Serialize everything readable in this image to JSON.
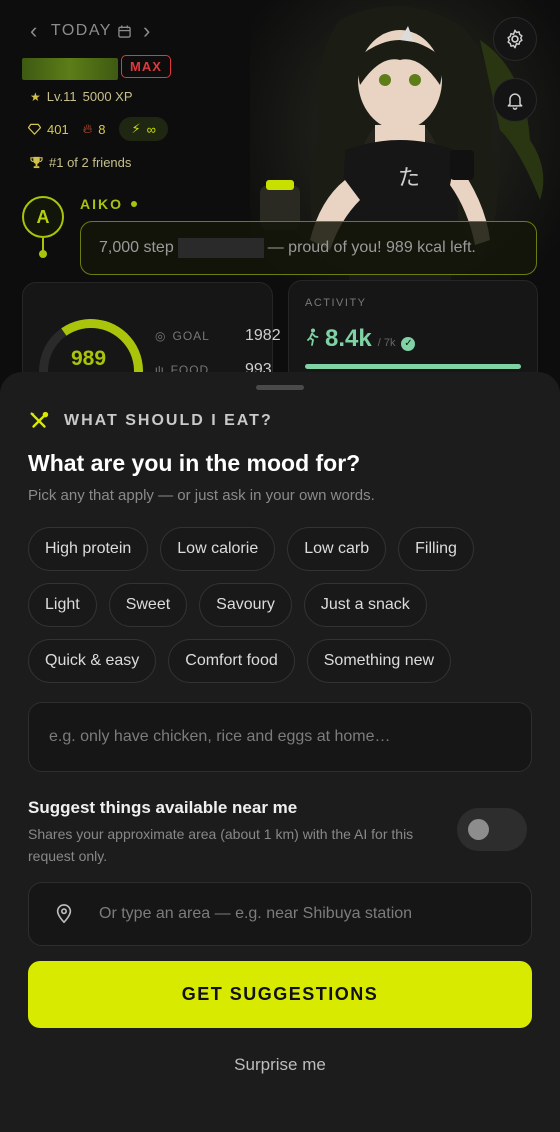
{
  "header": {
    "date_label": "TODAY",
    "max_badge": "MAX",
    "level": "Lv.11",
    "xp": "5000 XP",
    "gems": "401",
    "streak": "8",
    "energy": "∞",
    "rank": "#1 of 2 friends"
  },
  "companion": {
    "initial": "A",
    "name": "AIKO",
    "message_start": "7,000 step",
    "message_end": "— proud of you! 989 kcal left."
  },
  "calories_card": {
    "remaining": "989",
    "goal_label": "GOAL",
    "goal_value": "1982",
    "food_label": "FOOD",
    "food_value": "993"
  },
  "activity_card": {
    "label": "ACTIVITY",
    "steps": "8.4k",
    "target": "/ 7k"
  },
  "sheet": {
    "heading": "WHAT SHOULD I EAT?",
    "title": "What are you in the mood for?",
    "subtitle": "Pick any that apply — or just ask in your own words.",
    "chips_row1": [
      "High protein",
      "Low calorie",
      "Low carb",
      "Filling"
    ],
    "chips_row2": [
      "Light",
      "Sweet",
      "Savoury",
      "Just a snack"
    ],
    "chips_row3": [
      "Quick & easy",
      "Comfort food",
      "Something new"
    ],
    "input_placeholder": "e.g. only have chicken, rice and eggs at home…",
    "near_title": "Suggest things available near me",
    "near_desc": "Shares your approximate area (about 1 km) with the AI for this request only.",
    "near_toggle_on": false,
    "area_placeholder": "Or type an area — e.g. near Shibuya station",
    "cta_label": "GET SUGGESTIONS",
    "surprise_label": "Surprise me"
  },
  "colors": {
    "accent": "#d8ea00",
    "activity": "#7fd2a4",
    "max_red": "#e0383b"
  }
}
